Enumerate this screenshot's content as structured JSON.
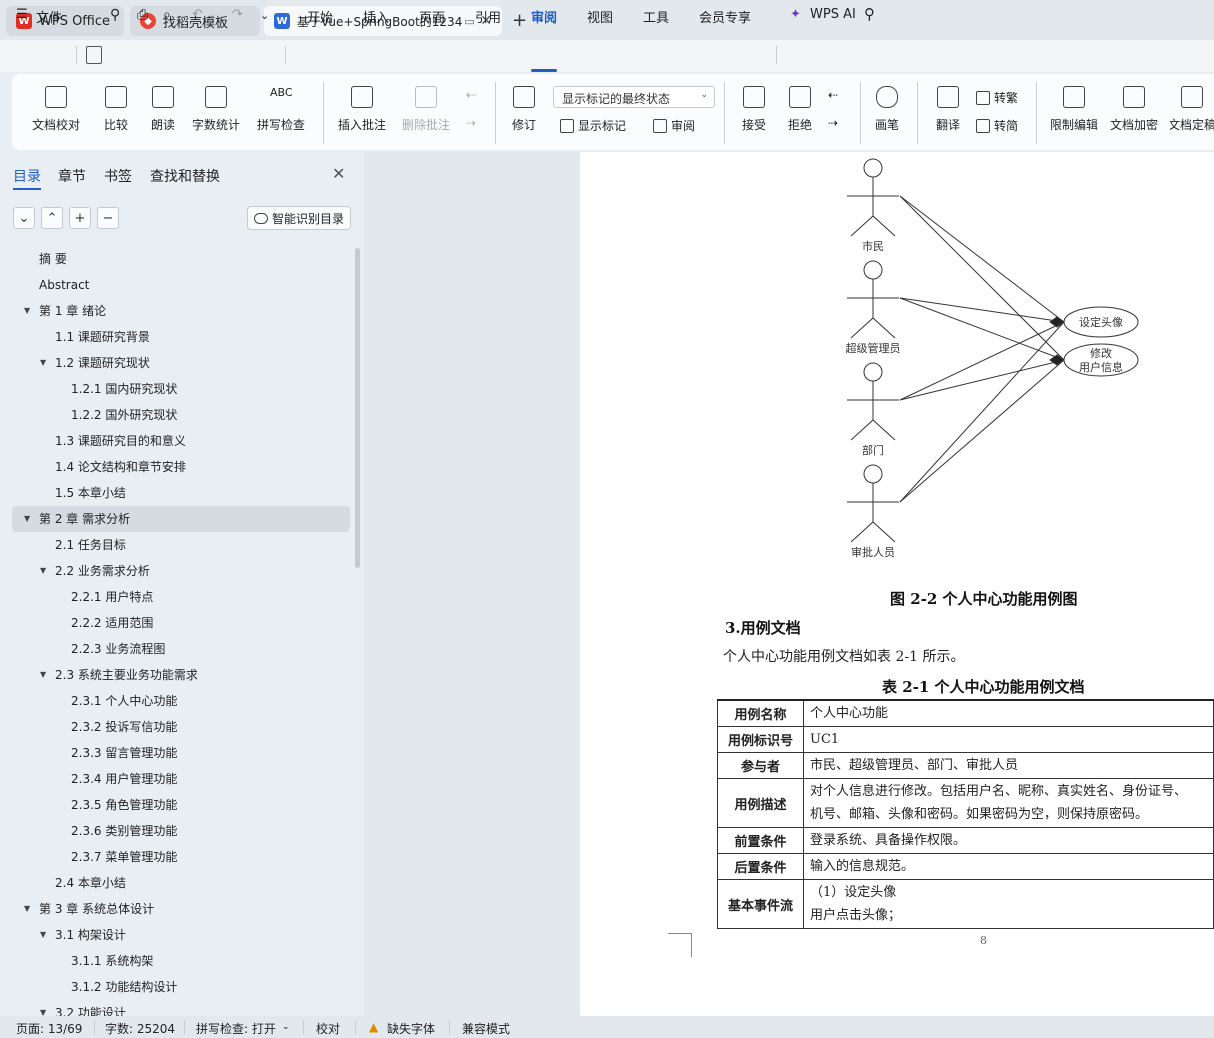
{
  "tabs": [
    {
      "label": "WPS Office",
      "icon": "wps-logo-icon"
    },
    {
      "label": "找稻壳模板",
      "icon": "docer-icon"
    },
    {
      "label": "基于Vue+SpringBoot的1234",
      "icon": "word-doc-icon",
      "active": true
    }
  ],
  "menu": {
    "file": "文件",
    "items": [
      "开始",
      "插入",
      "页面",
      "引用",
      "审阅",
      "视图",
      "工具",
      "会员专享"
    ],
    "active": "审阅",
    "ai": "WPS AI"
  },
  "ribbon": {
    "doc_check": "文档校对",
    "compare": "比较",
    "read_aloud": "朗读",
    "word_count": "字数统计",
    "spell_check": "拼写检查",
    "insert_comment": "插入批注",
    "delete_comment": "删除批注",
    "track_changes": "修订",
    "display_state": "显示标记的最终状态",
    "show_markup": "显示标记",
    "review": "审阅",
    "accept": "接受",
    "reject": "拒绝",
    "pen": "画笔",
    "translate": "翻译",
    "trad_simp": "转繁",
    "simp_trad": "转简",
    "restrict_edit": "限制编辑",
    "encrypt": "文档加密",
    "finalize": "文档定稿"
  },
  "panel": {
    "tabs": [
      "目录",
      "章节",
      "书签",
      "查找和替换"
    ],
    "smart_toc": "智能识别目录",
    "toc": [
      {
        "label": "摘  要",
        "level": 0
      },
      {
        "label": "Abstract",
        "level": 0
      },
      {
        "label": "第 1 章  绪论",
        "level": 0,
        "expand": true
      },
      {
        "label": "1.1 课题研究背景",
        "level": 1
      },
      {
        "label": "1.2 课题研究现状",
        "level": 1,
        "expand": true
      },
      {
        "label": "1.2.1 国内研究现状",
        "level": 2
      },
      {
        "label": "1.2.2 国外研究现状",
        "level": 2
      },
      {
        "label": "1.3 课题研究目的和意义",
        "level": 1
      },
      {
        "label": "1.4 论文结构和章节安排",
        "level": 1
      },
      {
        "label": "1.5 本章小结",
        "level": 1
      },
      {
        "label": "第 2 章  需求分析",
        "level": 0,
        "expand": true,
        "selected": true
      },
      {
        "label": "2.1 任务目标",
        "level": 1
      },
      {
        "label": "2.2 业务需求分析",
        "level": 1,
        "expand": true
      },
      {
        "label": "2.2.1 用户特点",
        "level": 2
      },
      {
        "label": "2.2.2 适用范围",
        "level": 2
      },
      {
        "label": "2.2.3 业务流程图",
        "level": 2
      },
      {
        "label": "2.3 系统主要业务功能需求",
        "level": 1,
        "expand": true
      },
      {
        "label": "2.3.1 个人中心功能",
        "level": 2
      },
      {
        "label": "2.3.2 投诉写信功能",
        "level": 2
      },
      {
        "label": "2.3.3 留言管理功能",
        "level": 2
      },
      {
        "label": "2.3.4 用户管理功能",
        "level": 2
      },
      {
        "label": "2.3.5 角色管理功能",
        "level": 2
      },
      {
        "label": "2.3.6 类别管理功能",
        "level": 2
      },
      {
        "label": "2.3.7 菜单管理功能",
        "level": 2
      },
      {
        "label": "2.4 本章小结",
        "level": 1
      },
      {
        "label": "第 3 章  系统总体设计",
        "level": 0,
        "expand": true
      },
      {
        "label": "3.1 构架设计",
        "level": 1,
        "expand": true
      },
      {
        "label": "3.1.1 系统构架",
        "level": 2
      },
      {
        "label": "3.1.2 功能结构设计",
        "level": 2
      },
      {
        "label": "3.2 功能设计",
        "level": 1,
        "expand": true
      }
    ]
  },
  "document": {
    "diagram": {
      "actors": [
        "市民",
        "超级管理员",
        "部门",
        "审批人员"
      ],
      "usecases": [
        "设定头像",
        "修改",
        "用户信息"
      ]
    },
    "figure_caption": "图 2-2 个人中心功能用例图",
    "heading": "3.用例文档",
    "paragraph": "个人中心功能用例文档如表 2-1 所示。",
    "table_caption": "表 2-1 个人中心功能用例文档",
    "table": [
      {
        "key": "用例名称",
        "value": [
          "个人中心功能"
        ]
      },
      {
        "key": "用例标识号",
        "value": [
          "UC1"
        ]
      },
      {
        "key": "参与者",
        "value": [
          "市民、超级管理员、部门、审批人员"
        ]
      },
      {
        "key": "用例描述",
        "value": [
          "对个人信息进行修改。包括用户名、昵称、真实姓名、身份证号、",
          "机号、邮箱、头像和密码。如果密码为空，则保持原密码。"
        ]
      },
      {
        "key": "前置条件",
        "value": [
          "登录系统、具备操作权限。"
        ]
      },
      {
        "key": "后置条件",
        "value": [
          "输入的信息规范。"
        ]
      },
      {
        "key": "基本事件流",
        "value": [
          "（1）设定头像",
          "用户点击头像；"
        ]
      }
    ],
    "page_number": "8"
  },
  "status": {
    "page": "页面: 13/69",
    "words": "字数: 25204",
    "spell": "拼写检查: 打开",
    "proof": "校对",
    "missing_font": "缺失字体",
    "compat": "兼容模式"
  }
}
